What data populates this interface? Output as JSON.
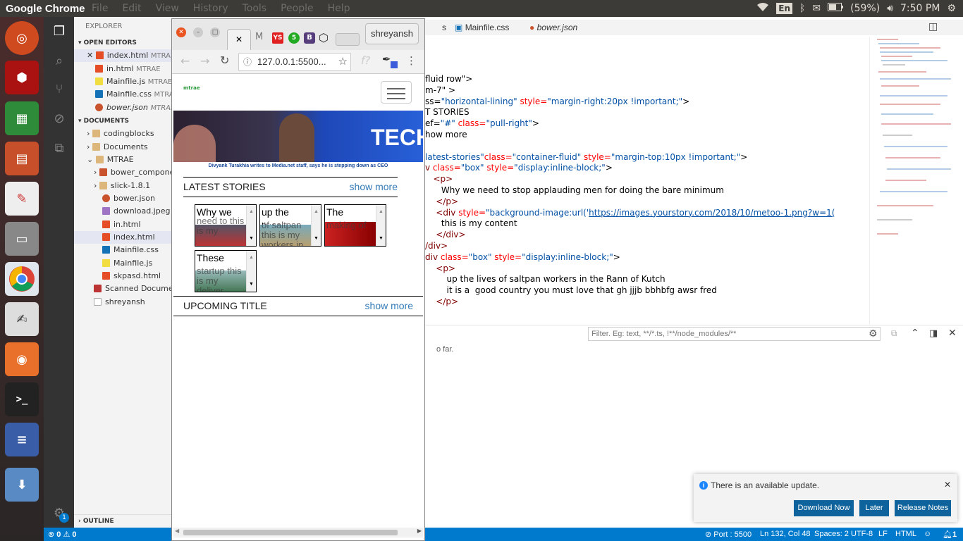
{
  "topbar": {
    "app_name": "Google Chrome",
    "menus": [
      "File",
      "Edit",
      "View",
      "History",
      "Tools",
      "People",
      "Help"
    ],
    "keyboard": "En",
    "battery": "(59%)",
    "time": "7:50 PM"
  },
  "explorer": {
    "title": "EXPLORER",
    "open_editors_label": "OPEN EDITORS",
    "open_editors": [
      {
        "name": "index.html",
        "suffix": "MTRAE",
        "type": "html"
      },
      {
        "name": "in.html",
        "suffix": "MTRAE",
        "type": "html"
      },
      {
        "name": "Mainfile.js",
        "suffix": "MTRAE",
        "type": "js"
      },
      {
        "name": "Mainfile.css",
        "suffix": "MTRA",
        "type": "css"
      },
      {
        "name": "bower.json",
        "suffix": "MTRAE",
        "type": "json"
      }
    ],
    "documents_label": "DOCUMENTS",
    "tree": [
      {
        "name": "codingblocks",
        "type": "folder"
      },
      {
        "name": "Documents",
        "type": "folder"
      },
      {
        "name": "MTRAE",
        "type": "folder-open"
      },
      {
        "name": "bower_compone",
        "type": "folder"
      },
      {
        "name": "slick-1.8.1",
        "type": "folder"
      },
      {
        "name": "bower.json",
        "type": "json"
      },
      {
        "name": "download.jpeg",
        "type": "image"
      },
      {
        "name": "in.html",
        "type": "html"
      },
      {
        "name": "index.html",
        "type": "html"
      },
      {
        "name": "Mainfile.css",
        "type": "css"
      },
      {
        "name": "Mainfile.js",
        "type": "js"
      },
      {
        "name": "skpasd.html",
        "type": "html"
      },
      {
        "name": "Scanned Documen",
        "type": "pdf"
      },
      {
        "name": "shreyansh",
        "type": "file"
      }
    ],
    "outline_label": "OUTLINE"
  },
  "editor_tabs": [
    {
      "label": "s",
      "type": "none"
    },
    {
      "label": "Mainfile.css",
      "type": "css"
    },
    {
      "label": "bower.json",
      "type": "json"
    }
  ],
  "code_lines": [
    {
      "parts": [
        [
          "tx",
          "fluid row\">"
        ]
      ]
    },
    {
      "parts": [
        [
          "tx",
          "m-7\" >"
        ]
      ]
    },
    {
      "parts": [
        [
          "tx",
          "ss="
        ],
        [
          "st",
          "\"horizontal-lining\""
        ],
        [
          "at",
          " style="
        ],
        [
          "st",
          "\"margin-right:20px !important;\""
        ],
        [
          "tx",
          ">"
        ]
      ]
    },
    {
      "parts": [
        [
          "tx",
          "T STORIES"
        ]
      ]
    },
    {
      "parts": [
        [
          "tx",
          "ef="
        ],
        [
          "st",
          "\"#\""
        ],
        [
          "at",
          " class="
        ],
        [
          "st",
          "\"pull-right\""
        ],
        [
          "tx",
          ">"
        ]
      ]
    },
    {
      "parts": [
        [
          "tx",
          "how more"
        ]
      ]
    },
    {
      "parts": [
        [
          "tx",
          ""
        ]
      ]
    },
    {
      "parts": [
        [
          "st",
          "latest-stories\""
        ],
        [
          "at",
          "class="
        ],
        [
          "st",
          "\"container-fluid\""
        ],
        [
          "at",
          " style="
        ],
        [
          "st",
          "\"margin-top:10px !important;\""
        ],
        [
          "tx",
          ">"
        ]
      ]
    },
    {
      "parts": [
        [
          "tg",
          "v"
        ],
        [
          "at",
          " class="
        ],
        [
          "st",
          "\"box\""
        ],
        [
          "at",
          " style="
        ],
        [
          "st",
          "\"display:inline-block;\""
        ],
        [
          "tx",
          ">"
        ]
      ]
    },
    {
      "parts": [
        [
          "tg",
          "   <p>"
        ]
      ]
    },
    {
      "parts": [
        [
          "tx",
          "      Why we need to stop applauding men for doing the bare minimum"
        ]
      ]
    },
    {
      "parts": [
        [
          "tg",
          "    </p>"
        ]
      ]
    },
    {
      "parts": [
        [
          "tg",
          "    <div"
        ],
        [
          "at",
          " style="
        ],
        [
          "st",
          "\"background-image:url('"
        ],
        [
          "st",
          "https://images.yourstory.com/2018/10/metoo-1.png?w=1("
        ]
      ]
    },
    {
      "parts": [
        [
          "tx",
          "      this is my content"
        ]
      ]
    },
    {
      "parts": [
        [
          "tg",
          "    </div>"
        ]
      ]
    },
    {
      "parts": [
        [
          "tg",
          "/div>"
        ]
      ]
    },
    {
      "parts": [
        [
          "tg",
          "div"
        ],
        [
          "at",
          " class="
        ],
        [
          "st",
          "\"box\""
        ],
        [
          "at",
          " style="
        ],
        [
          "st",
          "\"display:inline-block;\""
        ],
        [
          "tx",
          ">"
        ]
      ]
    },
    {
      "parts": [
        [
          "tg",
          "    <p>"
        ]
      ]
    },
    {
      "parts": [
        [
          "tx",
          "        up the lives of saltpan workers in the Rann of Kutch"
        ]
      ]
    },
    {
      "parts": [
        [
          "tx",
          "        it is a  good country you must love that gh jjjb bbhbfg awsr fred"
        ]
      ]
    },
    {
      "parts": [
        [
          "tg",
          "    </p>"
        ]
      ]
    }
  ],
  "panel": {
    "filter_placeholder": "Filter. Eg: text, **/*.ts, !**/node_modules/**",
    "message": "o far."
  },
  "notification": {
    "text": "There is an available update.",
    "buttons": [
      "Download Now",
      "Later",
      "Release Notes"
    ]
  },
  "status": {
    "errors": "0",
    "warnings": "0",
    "port": "Port : 5500",
    "position": "Ln 132, Col 48",
    "spaces": "Spaces: 2",
    "encoding": "UTF-8",
    "eol": "LF",
    "language": "HTML",
    "bell": "1"
  },
  "chrome": {
    "profile": "shreyansh",
    "url": "127.0.0.1:5500...",
    "tab_icons": [
      "YS",
      "5",
      "B"
    ],
    "site": {
      "logo": "mtrae",
      "hero_caption": "Divyank Turakhia writes to Media.net staff, says he is stepping down as CEO",
      "hero_banner_text": "TECH",
      "latest_title": "LATEST STORIES",
      "show_more": "show more",
      "stories": [
        {
          "title": "Why we",
          "overlay": "need to this is my"
        },
        {
          "title": "up the lives",
          "overlay": "of saltpan this is my workers in"
        },
        {
          "title": "The",
          "overlay": "making of"
        },
        {
          "title": "These",
          "overlay": "startup this is my deliver"
        }
      ],
      "upcoming_title": "UPCOMING TITLE",
      "upcoming_show_more": "show more"
    }
  },
  "launcher_badge": "1"
}
